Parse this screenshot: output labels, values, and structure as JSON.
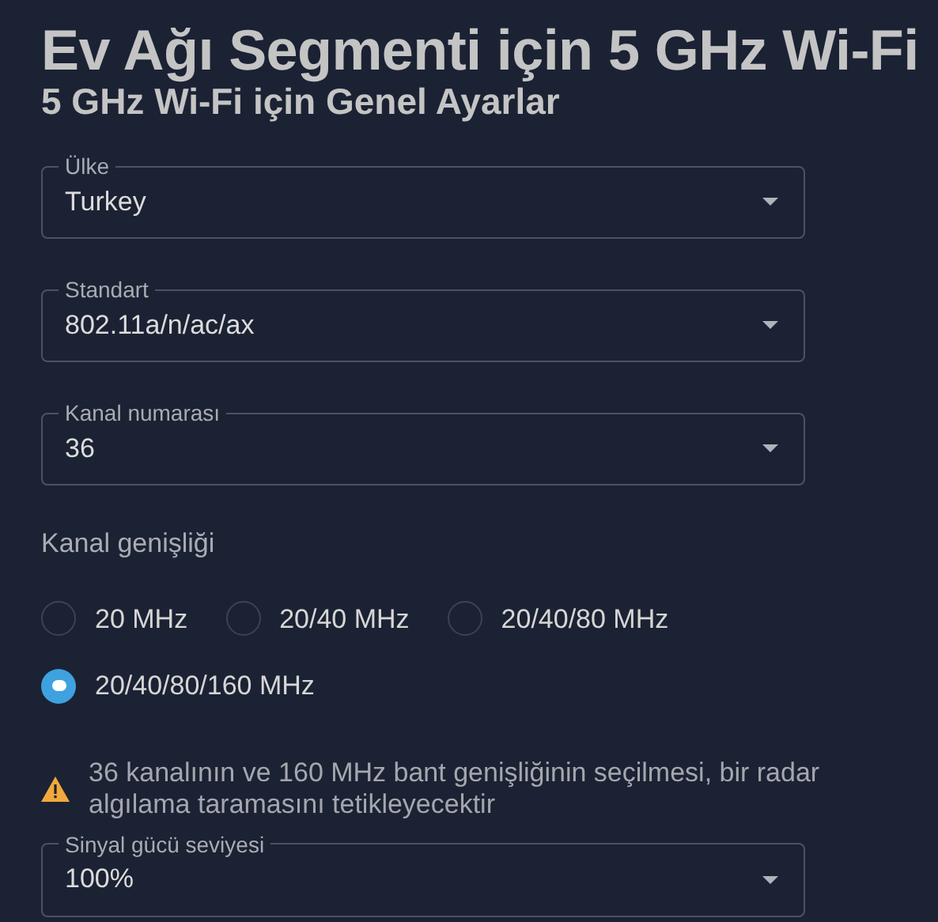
{
  "title": "Ev Ağı Segmenti için 5 GHz Wi-Fi",
  "subtitle": "5 GHz Wi-Fi için Genel Ayarlar",
  "selects": [
    {
      "label": "Ülke",
      "value": "Turkey"
    },
    {
      "label": "Standart",
      "value": "802.11a/n/ac/ax"
    },
    {
      "label": "Kanal numarası",
      "value": "36"
    }
  ],
  "channel_width": {
    "label": "Kanal genişliği",
    "options": [
      {
        "label": "20 MHz",
        "selected": false
      },
      {
        "label": "20/40 MHz",
        "selected": false
      },
      {
        "label": "20/40/80 MHz",
        "selected": false
      },
      {
        "label": "20/40/80/160 MHz",
        "selected": true
      }
    ]
  },
  "warning": "36 kanalının ve 160 MHz bant genişliğinin seçilmesi, bir radar algılama taramasını tetikleyecektir",
  "signal_select": {
    "label": "Sinyal gücü seviyesi",
    "value": "100%"
  }
}
